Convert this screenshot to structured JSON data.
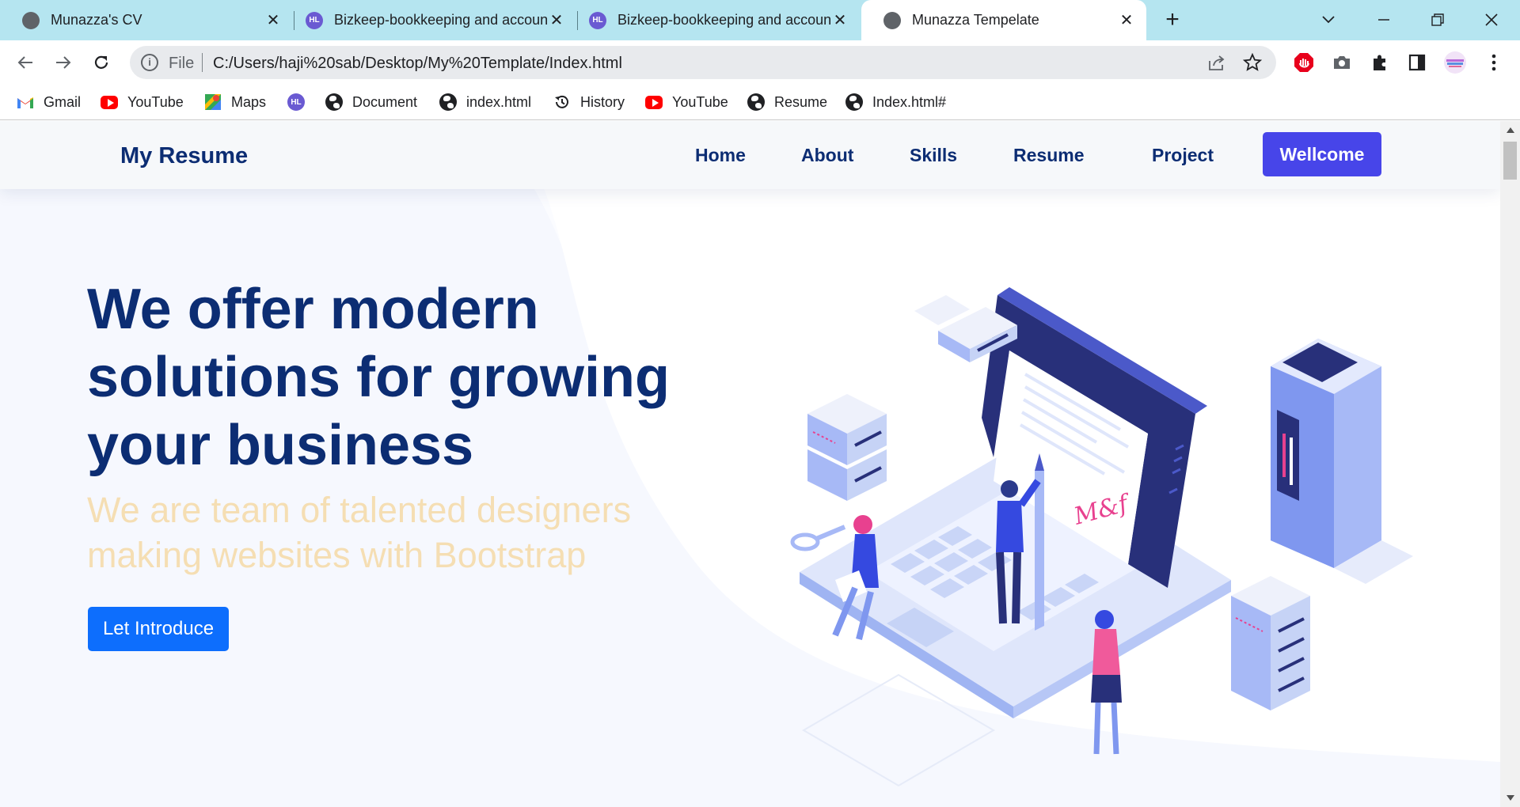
{
  "browser": {
    "tabs": [
      {
        "title": "Munazza's CV",
        "favicon": "globe-icon",
        "active": false
      },
      {
        "title": "Bizkeep-bookkeeping and accounting",
        "favicon": "hl-logo-icon",
        "active": false
      },
      {
        "title": "Bizkeep-bookkeeping and accounting",
        "favicon": "hl-logo-icon",
        "active": false
      },
      {
        "title": "Munazza Tempelate",
        "favicon": "globe-icon",
        "active": true
      }
    ],
    "new_tab": "+",
    "favicon_text": "HL",
    "address": {
      "scheme_label": "File",
      "url": "C:/Users/haji%20sab/Desktop/My%20Template/Index.html"
    },
    "bookmarks": [
      {
        "label": "Gmail",
        "icon": "gmail-icon"
      },
      {
        "label": "YouTube",
        "icon": "youtube-icon"
      },
      {
        "label": "Maps",
        "icon": "maps-icon"
      },
      {
        "label": "",
        "icon": "hl-logo-icon"
      },
      {
        "label": "Document",
        "icon": "globe-icon"
      },
      {
        "label": "index.html",
        "icon": "globe-icon"
      },
      {
        "label": "History",
        "icon": "history-icon"
      },
      {
        "label": "YouTube",
        "icon": "youtube-icon"
      },
      {
        "label": "Resume",
        "icon": "globe-icon"
      },
      {
        "label": "Index.html#",
        "icon": "globe-icon"
      }
    ]
  },
  "site": {
    "brand": "My Resume",
    "nav": [
      "Home",
      "About",
      "Skills",
      "Resume",
      "Project"
    ],
    "cta": "Wellcome"
  },
  "hero": {
    "title": "We offer modern solutions for growing your business",
    "subtitle": "We are team of talented designers making websites with Bootstrap",
    "button": "Let Introduce",
    "signature": "M&f"
  },
  "colors": {
    "navy": "#0c2d73",
    "subtitle": "#f5deb3",
    "cta": "#4745e9",
    "button": "#0d6efd",
    "tabstrip": "#b5e5f0"
  }
}
